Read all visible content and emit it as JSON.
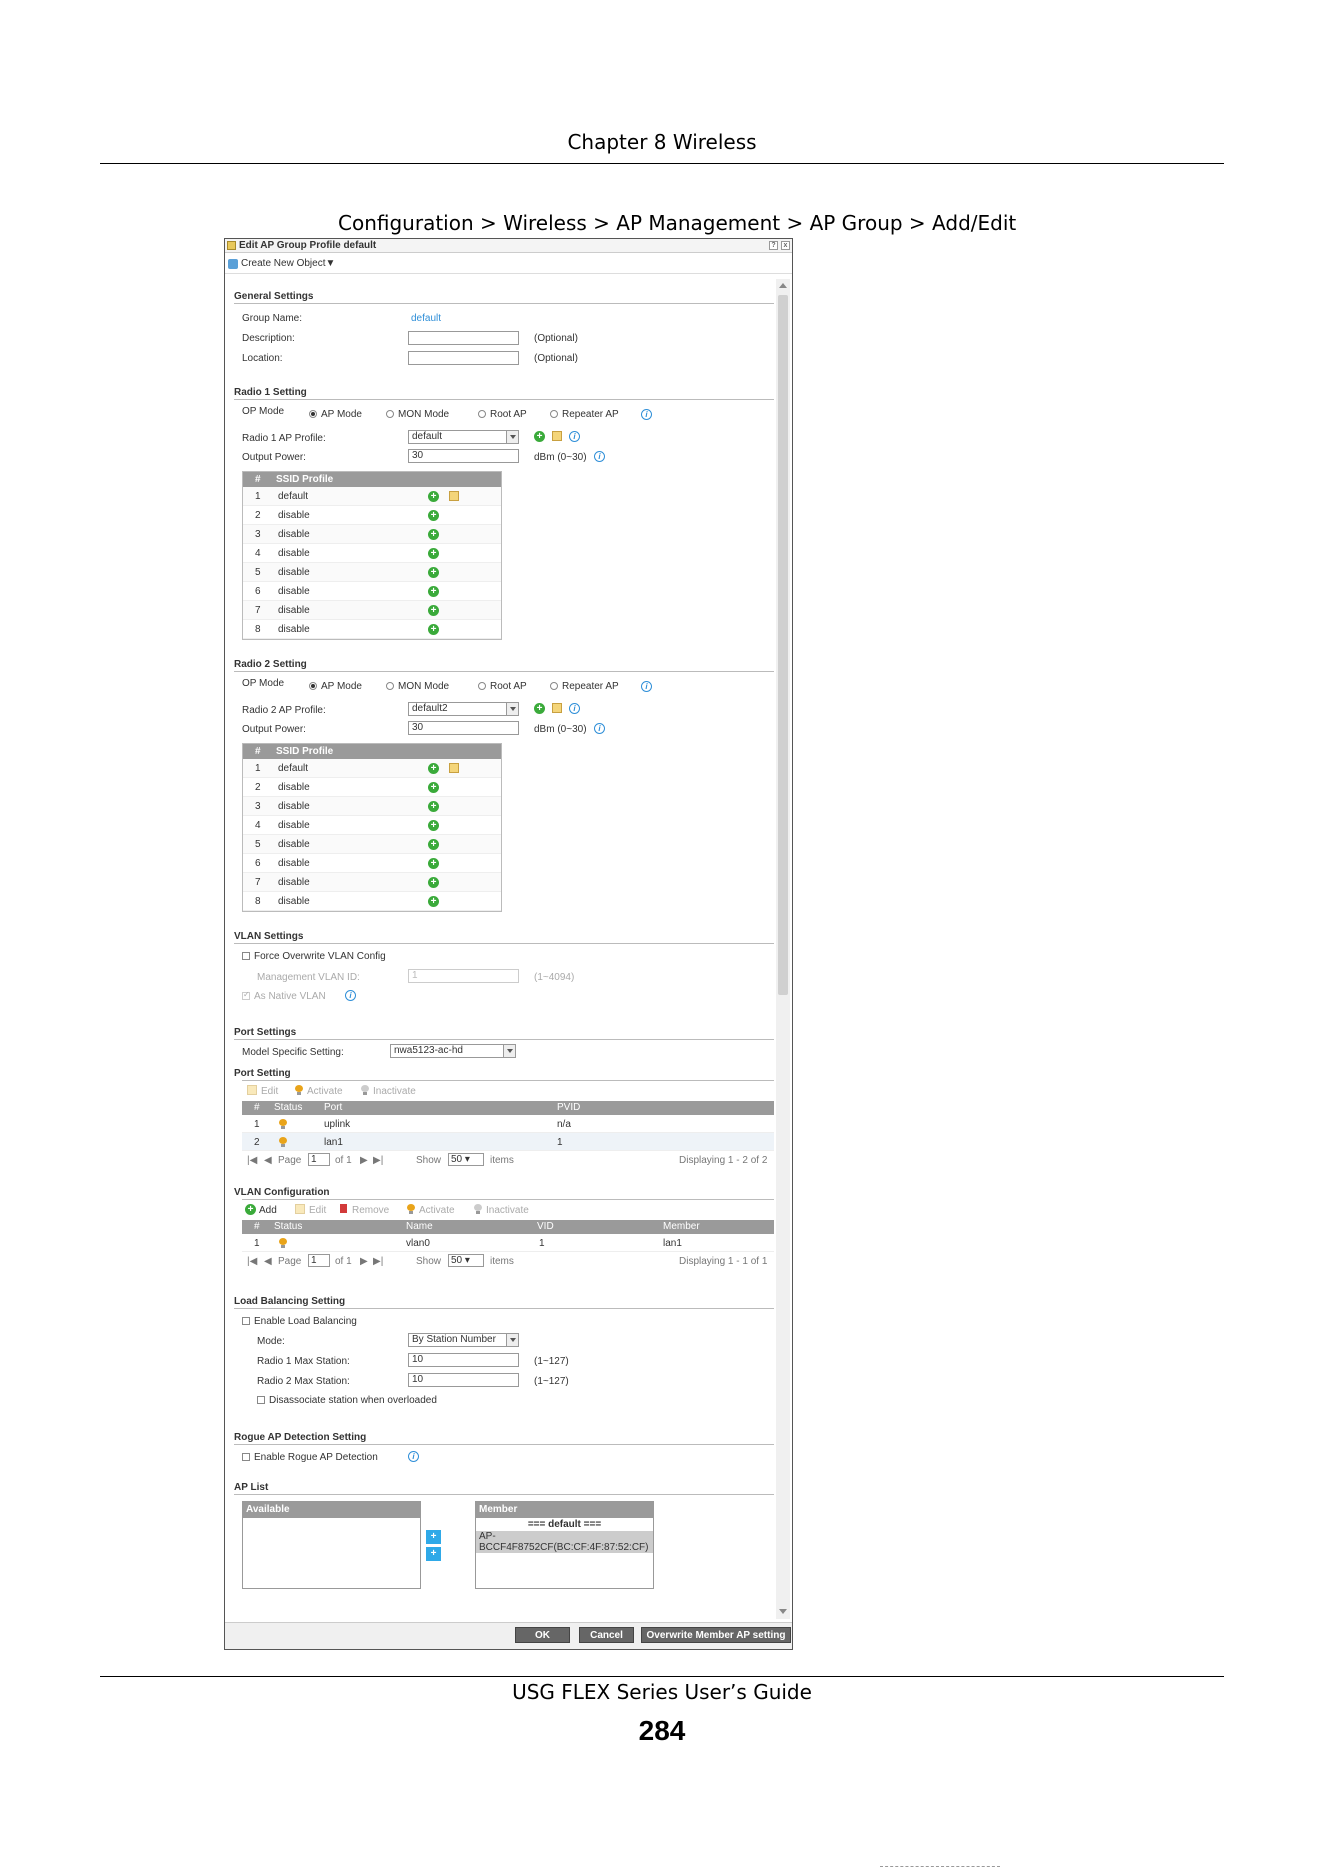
{
  "doc": {
    "chapter_header": "Chapter 8 Wireless",
    "caption": "Configuration > Wireless > AP Management > AP Group > Add/Edit",
    "footer_title": "USG FLEX Series User’s Guide",
    "page_number": "284"
  },
  "dialog": {
    "title": "Edit AP Group Profile default",
    "help_btn": "?",
    "close_btn": "x",
    "create_new_object": "Create New Object▼",
    "general": {
      "heading": "General Settings",
      "group_name_label": "Group Name:",
      "group_name_value": "default",
      "description_label": "Description:",
      "description_hint": "(Optional)",
      "location_label": "Location:",
      "location_hint": "(Optional)"
    },
    "radio1": {
      "heading": "Radio 1 Setting",
      "op_mode_label": "OP Mode",
      "modes": [
        "AP Mode",
        "MON Mode",
        "Root AP",
        "Repeater AP"
      ],
      "profile_label": "Radio 1 AP Profile:",
      "profile_value": "default",
      "power_label": "Output Power:",
      "power_value": "30",
      "power_unit": "dBm (0~30)",
      "table_hash": "#",
      "table_header": "SSID Profile",
      "rows": [
        {
          "n": "1",
          "v": "default"
        },
        {
          "n": "2",
          "v": "disable"
        },
        {
          "n": "3",
          "v": "disable"
        },
        {
          "n": "4",
          "v": "disable"
        },
        {
          "n": "5",
          "v": "disable"
        },
        {
          "n": "6",
          "v": "disable"
        },
        {
          "n": "7",
          "v": "disable"
        },
        {
          "n": "8",
          "v": "disable"
        }
      ]
    },
    "radio2": {
      "heading": "Radio 2 Setting",
      "op_mode_label": "OP Mode",
      "modes": [
        "AP Mode",
        "MON Mode",
        "Root AP",
        "Repeater AP"
      ],
      "profile_label": "Radio 2 AP Profile:",
      "profile_value": "default2",
      "power_label": "Output Power:",
      "power_value": "30",
      "power_unit": "dBm (0~30)",
      "table_hash": "#",
      "table_header": "SSID Profile",
      "rows": [
        {
          "n": "1",
          "v": "default"
        },
        {
          "n": "2",
          "v": "disable"
        },
        {
          "n": "3",
          "v": "disable"
        },
        {
          "n": "4",
          "v": "disable"
        },
        {
          "n": "5",
          "v": "disable"
        },
        {
          "n": "6",
          "v": "disable"
        },
        {
          "n": "7",
          "v": "disable"
        },
        {
          "n": "8",
          "v": "disable"
        }
      ]
    },
    "vlan": {
      "heading": "VLAN Settings",
      "force_label": "Force Overwrite VLAN Config",
      "mgmt_label": "Management VLAN ID:",
      "mgmt_value": "1",
      "mgmt_hint": "(1~4094)",
      "native_label": "As Native VLAN"
    },
    "port": {
      "heading": "Port Settings",
      "model_label": "Model Specific Setting:",
      "model_value": "nwa5123-ac-hd",
      "sub_heading": "Port Setting",
      "toolbar": [
        "Edit",
        "Activate",
        "Inactivate"
      ],
      "cols": [
        "#",
        "Status",
        "Port",
        "PVID"
      ],
      "rows": [
        {
          "n": "1",
          "port": "uplink",
          "pvid": "n/a"
        },
        {
          "n": "2",
          "port": "lan1",
          "pvid": "1"
        }
      ],
      "pager": {
        "page": "Page",
        "page_val": "1",
        "of": "of 1",
        "show": "Show",
        "show_val": "50",
        "items": "items",
        "displaying": "Displaying 1 - 2 of 2"
      }
    },
    "vlan_conf": {
      "heading": "VLAN Configuration",
      "toolbar": [
        "Add",
        "Edit",
        "Remove",
        "Activate",
        "Inactivate"
      ],
      "cols": [
        "#",
        "Status",
        "Name",
        "VID",
        "Member"
      ],
      "rows": [
        {
          "n": "1",
          "name": "vlan0",
          "vid": "1",
          "member": "lan1"
        }
      ],
      "pager": {
        "page": "Page",
        "page_val": "1",
        "of": "of 1",
        "show": "Show",
        "show_val": "50",
        "items": "items",
        "displaying": "Displaying 1 - 1 of 1"
      }
    },
    "lb": {
      "heading": "Load Balancing Setting",
      "enable_label": "Enable Load Balancing",
      "mode_label": "Mode:",
      "mode_value": "By Station Number",
      "r1_label": "Radio 1 Max Station:",
      "r1_value": "10",
      "r1_hint": "(1~127)",
      "r2_label": "Radio 2 Max Station:",
      "r2_value": "10",
      "r2_hint": "(1~127)",
      "disassoc_label": "Disassociate station when overloaded"
    },
    "rogue": {
      "heading": "Rogue AP Detection Setting",
      "enable_label": "Enable Rogue AP Detection"
    },
    "aplist": {
      "heading": "AP List",
      "available": "Available",
      "member": "Member",
      "member_group": "=== default ===",
      "member_item1": "AP-",
      "member_item2": "BCCF4F8752CF(BC:CF:4F:87:52:CF)",
      "add_btn": "+",
      "remove_btn": "+"
    },
    "buttons": {
      "ok": "OK",
      "cancel": "Cancel",
      "overwrite": "Overwrite Member AP setting"
    }
  }
}
